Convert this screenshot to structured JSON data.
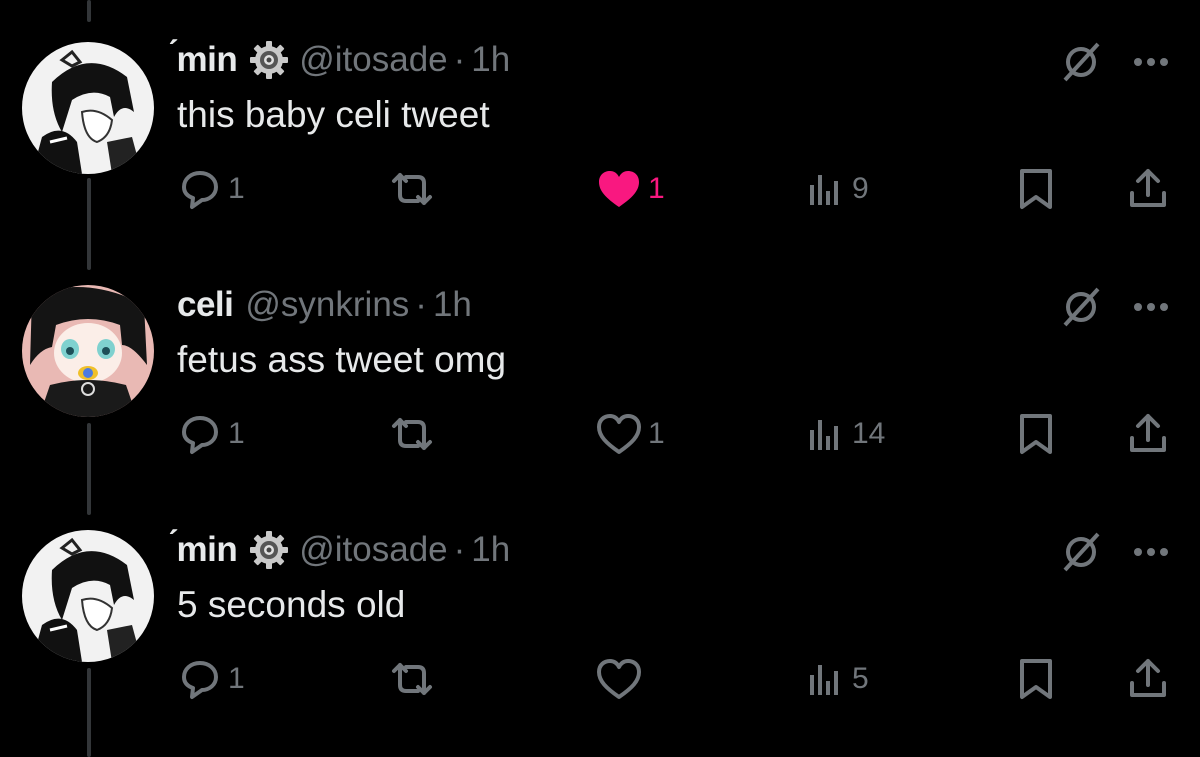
{
  "colors": {
    "background": "#000000",
    "text": "#e7e9ea",
    "muted": "#71767b",
    "like_active": "#f91880",
    "thread_line": "#333639"
  },
  "tweets": [
    {
      "display_name": "́min",
      "verified_badge": "gear-badge-icon",
      "handle": "@itosade",
      "dot": "·",
      "time": "1h",
      "text": "this baby celi tweet",
      "replies": "1",
      "reposts": "",
      "likes": "1",
      "liked": true,
      "views": "9",
      "avatar": "monochrome-anime-avatar"
    },
    {
      "display_name": "celi",
      "verified_badge": "",
      "handle": "@synkrins",
      "dot": "·",
      "time": "1h",
      "text": "fetus ass tweet omg",
      "replies": "1",
      "reposts": "",
      "likes": "1",
      "liked": false,
      "views": "14",
      "avatar": "pacifier-anime-avatar"
    },
    {
      "display_name": "́min",
      "verified_badge": "gear-badge-icon",
      "handle": "@itosade",
      "dot": "·",
      "time": "1h",
      "text": "5 seconds old",
      "replies": "1",
      "reposts": "",
      "likes": "",
      "liked": false,
      "views": "5",
      "avatar": "monochrome-anime-avatar"
    }
  ]
}
